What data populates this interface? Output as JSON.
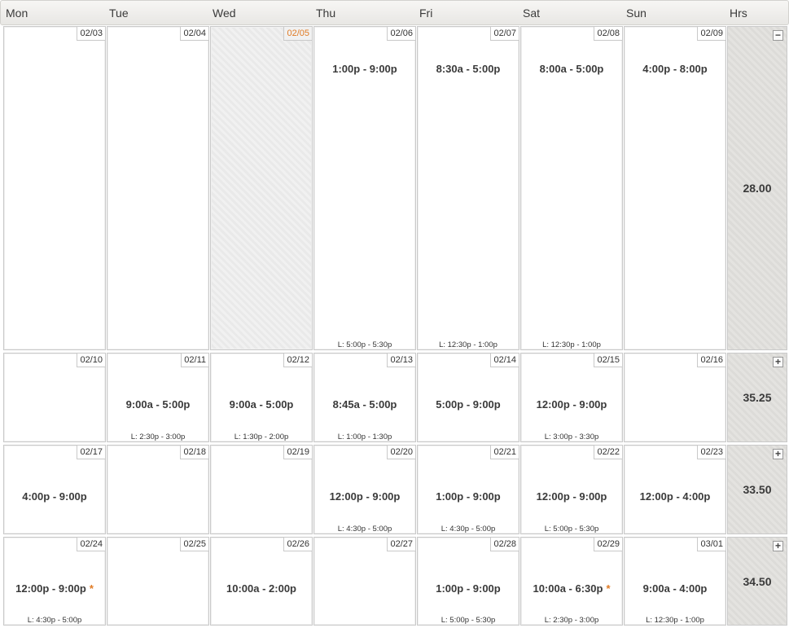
{
  "header": {
    "days": [
      "Mon",
      "Tue",
      "Wed",
      "Thu",
      "Fri",
      "Sat",
      "Sun"
    ],
    "hrs_label": "Hrs"
  },
  "colors": {
    "accent": "#e07b25",
    "border": "#c9c9c9"
  },
  "weeks": [
    {
      "hours": "28.00",
      "toggle": "−",
      "days": [
        {
          "date": "02/03",
          "shift": "",
          "lunch": ""
        },
        {
          "date": "02/04",
          "shift": "",
          "lunch": ""
        },
        {
          "date": "02/05",
          "shift": "",
          "lunch": "",
          "today": true
        },
        {
          "date": "02/06",
          "shift": "1:00p - 9:00p",
          "lunch": "L: 5:00p - 5:30p"
        },
        {
          "date": "02/07",
          "shift": "8:30a - 5:00p",
          "lunch": "L: 12:30p - 1:00p"
        },
        {
          "date": "02/08",
          "shift": "8:00a - 5:00p",
          "lunch": "L: 12:30p - 1:00p"
        },
        {
          "date": "02/09",
          "shift": "4:00p - 8:00p",
          "lunch": ""
        }
      ]
    },
    {
      "hours": "35.25",
      "toggle": "+",
      "days": [
        {
          "date": "02/10",
          "shift": "",
          "lunch": ""
        },
        {
          "date": "02/11",
          "shift": "9:00a - 5:00p",
          "lunch": "L: 2:30p - 3:00p"
        },
        {
          "date": "02/12",
          "shift": "9:00a - 5:00p",
          "lunch": "L: 1:30p - 2:00p"
        },
        {
          "date": "02/13",
          "shift": "8:45a - 5:00p",
          "lunch": "L: 1:00p - 1:30p"
        },
        {
          "date": "02/14",
          "shift": "5:00p - 9:00p",
          "lunch": ""
        },
        {
          "date": "02/15",
          "shift": "12:00p - 9:00p",
          "lunch": "L: 3:00p - 3:30p"
        },
        {
          "date": "02/16",
          "shift": "",
          "lunch": ""
        }
      ]
    },
    {
      "hours": "33.50",
      "toggle": "+",
      "days": [
        {
          "date": "02/17",
          "shift": "4:00p - 9:00p",
          "lunch": ""
        },
        {
          "date": "02/18",
          "shift": "",
          "lunch": ""
        },
        {
          "date": "02/19",
          "shift": "",
          "lunch": ""
        },
        {
          "date": "02/20",
          "shift": "12:00p - 9:00p",
          "lunch": "L: 4:30p - 5:00p"
        },
        {
          "date": "02/21",
          "shift": "1:00p - 9:00p",
          "lunch": "L: 4:30p - 5:00p"
        },
        {
          "date": "02/22",
          "shift": "12:00p - 9:00p",
          "lunch": "L: 5:00p - 5:30p"
        },
        {
          "date": "02/23",
          "shift": "12:00p - 4:00p",
          "lunch": ""
        }
      ]
    },
    {
      "hours": "34.50",
      "toggle": "+",
      "days": [
        {
          "date": "02/24",
          "shift": "12:00p - 9:00p",
          "lunch": "L: 4:30p - 5:00p",
          "star": "*"
        },
        {
          "date": "02/25",
          "shift": "",
          "lunch": ""
        },
        {
          "date": "02/26",
          "shift": "10:00a - 2:00p",
          "lunch": ""
        },
        {
          "date": "02/27",
          "shift": "",
          "lunch": ""
        },
        {
          "date": "02/28",
          "shift": "1:00p - 9:00p",
          "lunch": "L: 5:00p - 5:30p"
        },
        {
          "date": "02/29",
          "shift": "10:00a - 6:30p",
          "lunch": "L: 2:30p - 3:00p",
          "star": "*"
        },
        {
          "date": "03/01",
          "shift": "9:00a - 4:00p",
          "lunch": "L: 12:30p - 1:00p"
        }
      ]
    }
  ]
}
